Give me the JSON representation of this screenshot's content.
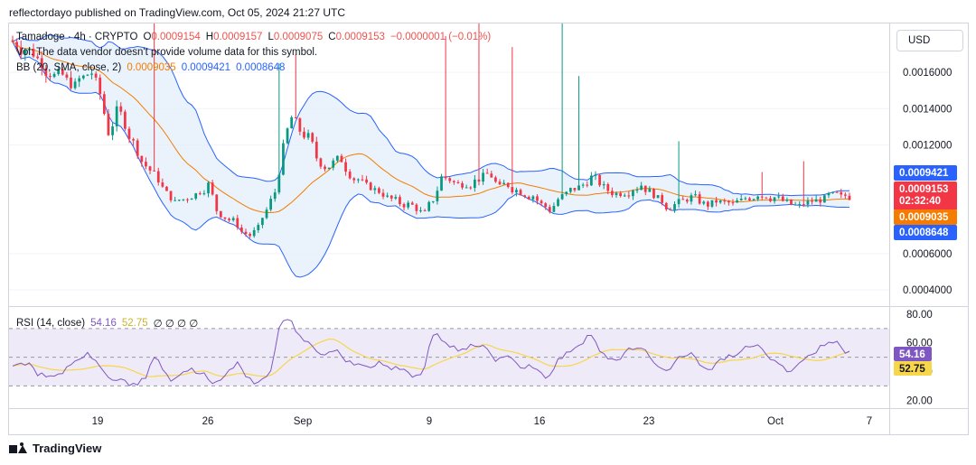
{
  "header": {
    "publisher_line": "reflectordayo published on TradingView.com, Oct 05, 2024 21:27 UTC"
  },
  "footer": {
    "brand": "TradingView"
  },
  "scale_button": {
    "label": "USD"
  },
  "legend": {
    "symbol": "Tamadoge · 4h · CRYPTO",
    "open_label": "O",
    "open": "0.0009154",
    "high_label": "H",
    "high": "0.0009157",
    "low_label": "L",
    "low": "0.0009075",
    "close_label": "C",
    "close": "0.0009153",
    "change": "−0.0000001 (−0.01%)",
    "volume_warning": "Vol: The data vendor doesn't provide volume data for this symbol.",
    "bb_title": "BB (20, SMA, close, 2)",
    "bb_basis": "0.0009035",
    "bb_upper": "0.0009421",
    "bb_lower": "0.0008648",
    "rsi_title": "RSI (14, close)",
    "rsi_value": "54.16",
    "rsi_ma": "52.75",
    "rsi_extra": "∅  ∅  ∅  ∅"
  },
  "colors": {
    "up": "#089981",
    "down": "#f23645",
    "basis": "#f57c00",
    "band": "#2962ff",
    "band_fill": "#e3effb",
    "rsi": "#7e57c2",
    "rsi_ma": "#f7d64a",
    "rsi_zone": "#efeaf8",
    "axis_text": "#131722",
    "grid": "#f0f3fa"
  },
  "price_axis": {
    "ticks": [
      "0.0016000",
      "0.0014000",
      "0.0012000",
      "0.0006000",
      "0.0004000"
    ],
    "badges": {
      "upper": "0.0009421",
      "price": "0.0009153",
      "countdown": "02:32:40",
      "basis": "0.0009035",
      "lower": "0.0008648"
    }
  },
  "rsi_axis": {
    "ticks": [
      "80.00",
      "60.00",
      "40.00",
      "20.00"
    ],
    "badges": {
      "rsi": "54.16",
      "ma": "52.75"
    }
  },
  "time_axis": {
    "labels": [
      "19",
      "26",
      "Sep",
      "9",
      "16",
      "23",
      "Oct",
      "7"
    ]
  },
  "chart_data": {
    "type": "candlestick",
    "title": "Tamadoge · 4h · CRYPTO",
    "y_range": [
      0.00031,
      0.00187
    ],
    "rsi_range": [
      14.5,
      85
    ],
    "rsi_levels": [
      70,
      50,
      30
    ],
    "x_labels": [
      "19",
      "26",
      "Sep",
      "9",
      "16",
      "23",
      "Oct",
      "7"
    ],
    "bollinger": {
      "length": 20,
      "type": "SMA",
      "mult": 2,
      "basis": 0.0009035,
      "upper": 0.0009421,
      "lower": 0.0008648
    },
    "series_close": [
      0.00176,
      0.00173,
      0.00171,
      0.00166,
      0.0016,
      0.00158,
      0.00155,
      0.00152,
      0.00157,
      0.0016,
      0.00148,
      0.00127,
      0.00138,
      0.00132,
      0.00121,
      0.00111,
      0.00106,
      0.00101,
      0.00093,
      0.00088,
      0.0009,
      0.00092,
      0.00095,
      0.00098,
      0.00084,
      0.0008,
      0.00078,
      0.00072,
      0.0007,
      0.00074,
      0.00084,
      0.00094,
      0.00118,
      0.00135,
      0.00128,
      0.00124,
      0.00113,
      0.00108,
      0.0011,
      0.00112,
      0.00104,
      0.00101,
      0.00097,
      0.00095,
      0.00093,
      0.0009,
      0.00088,
      0.00087,
      0.00085,
      0.00082,
      0.0009,
      0.00102,
      0.00101,
      0.00098,
      0.00099,
      0.001,
      0.00102,
      0.00103,
      0.00096,
      0.00098,
      0.00095,
      0.00093,
      0.00092,
      0.00087,
      0.00084,
      0.0009,
      0.00093,
      0.00096,
      0.00098,
      0.00102,
      0.00099,
      0.00095,
      0.00093,
      0.00094,
      0.00096,
      0.00098,
      0.00094,
      0.0009,
      0.00086,
      0.00087,
      0.00089,
      0.00091,
      0.00089,
      0.00087,
      0.00089,
      0.00088,
      0.00087,
      0.00089,
      0.00091,
      0.00093,
      0.00092,
      0.00091,
      0.00089,
      0.00087,
      0.00086,
      0.00088,
      0.00089,
      0.0009,
      0.00092,
      0.00091,
      0.000915
    ],
    "spikes": [
      {
        "index": 17,
        "high": 0.00187
      },
      {
        "index": 32,
        "high": 0.00165
      },
      {
        "index": 34,
        "high": 0.0017
      },
      {
        "index": 52,
        "high": 0.0018
      },
      {
        "index": 56,
        "high": 0.00187
      },
      {
        "index": 60,
        "high": 0.00174
      },
      {
        "index": 66,
        "high": 0.00187
      },
      {
        "index": 68,
        "high": 0.00158
      },
      {
        "index": 80,
        "high": 0.00122
      },
      {
        "index": 90,
        "high": 0.00105
      },
      {
        "index": 95,
        "high": 0.00111
      }
    ],
    "rsi": [
      46,
      44,
      45,
      40,
      38,
      36,
      41,
      46,
      49,
      51,
      47,
      39,
      32,
      36,
      31,
      33,
      38,
      53,
      41,
      34,
      37,
      44,
      40,
      36,
      32,
      35,
      41,
      45,
      37,
      33,
      32,
      45,
      73,
      80,
      66,
      63,
      56,
      50,
      55,
      52,
      48,
      46,
      44,
      43,
      46,
      41,
      42,
      40,
      38,
      36,
      66,
      63,
      58,
      54,
      55,
      57,
      60,
      52,
      49,
      52,
      47,
      42,
      43,
      40,
      35,
      48,
      53,
      56,
      58,
      67,
      55,
      49,
      47,
      53,
      55,
      57,
      51,
      44,
      40,
      46,
      50,
      54,
      45,
      41,
      46,
      48,
      50,
      54,
      57,
      59,
      52,
      48,
      44,
      40,
      46,
      51,
      53,
      58,
      60,
      57,
      54.16
    ]
  }
}
